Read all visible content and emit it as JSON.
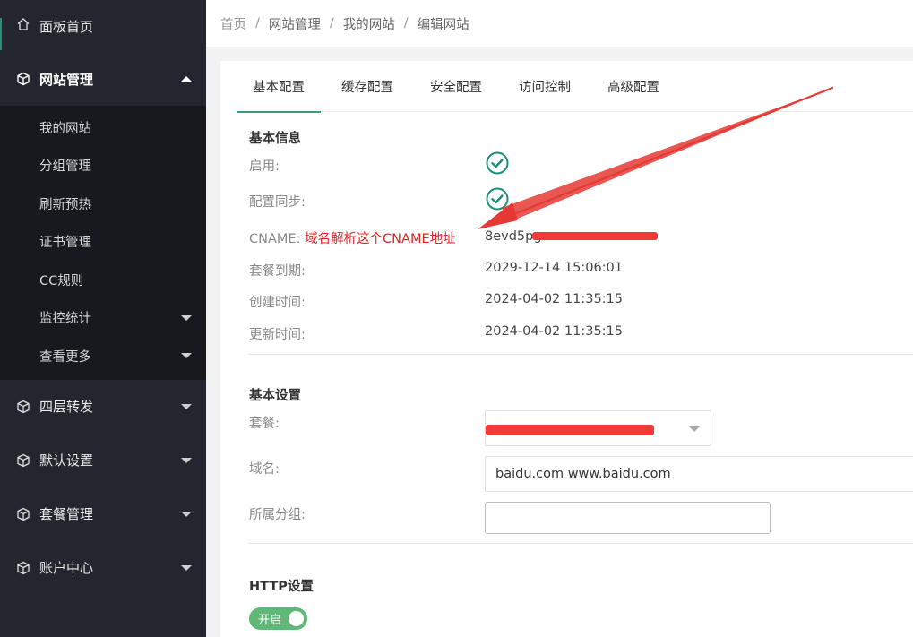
{
  "sidebar": {
    "home": {
      "label": "面板首页",
      "icon": "home-icon"
    },
    "website_group": {
      "label": "网站管理",
      "icon": "cube-icon"
    },
    "website_items": [
      {
        "label": "我的网站"
      },
      {
        "label": "分组管理"
      },
      {
        "label": "刷新预热"
      },
      {
        "label": "证书管理"
      },
      {
        "label": "CC规则"
      },
      {
        "label": "监控统计"
      },
      {
        "label": "查看更多"
      }
    ],
    "groups": [
      {
        "label": "四层转发",
        "icon": "cube-icon"
      },
      {
        "label": "默认设置",
        "icon": "cube-icon"
      },
      {
        "label": "套餐管理",
        "icon": "cube-icon"
      },
      {
        "label": "账户中心",
        "icon": "cube-icon"
      }
    ]
  },
  "breadcrumb": [
    "首页",
    "网站管理",
    "我的网站",
    "编辑网站"
  ],
  "breadcrumb_sep": "/",
  "tabs": [
    "基本配置",
    "缓存配置",
    "安全配置",
    "访问控制",
    "高级配置"
  ],
  "basic_info": {
    "title": "基本信息",
    "enabled_label": "启用:",
    "sync_label": "配置同步:",
    "cname_label": "CNAME:",
    "cname_annotation": "域名解析这个CNAME地址",
    "cname_value_visible": "8evd5pg",
    "expire_label": "套餐到期:",
    "expire_value": "2029-12-14 15:06:01",
    "created_label": "创建时间:",
    "created_value": "2024-04-02 11:35:15",
    "updated_label": "更新时间:",
    "updated_value": "2024-04-02 11:35:15"
  },
  "basic_settings": {
    "title": "基本设置",
    "plan_label": "套餐:",
    "domain_label": "域名:",
    "domain_value": "baidu.com www.baidu.com",
    "group_label": "所属分组:"
  },
  "http_settings": {
    "title": "HTTP设置",
    "switch_label": "开启",
    "switch_on": true
  },
  "colors": {
    "sidebar_bg": "#23262e",
    "submenu_bg": "#17191f",
    "accent": "#2c8f72",
    "switch_on": "#5fb878",
    "annotation": "#e02424"
  }
}
